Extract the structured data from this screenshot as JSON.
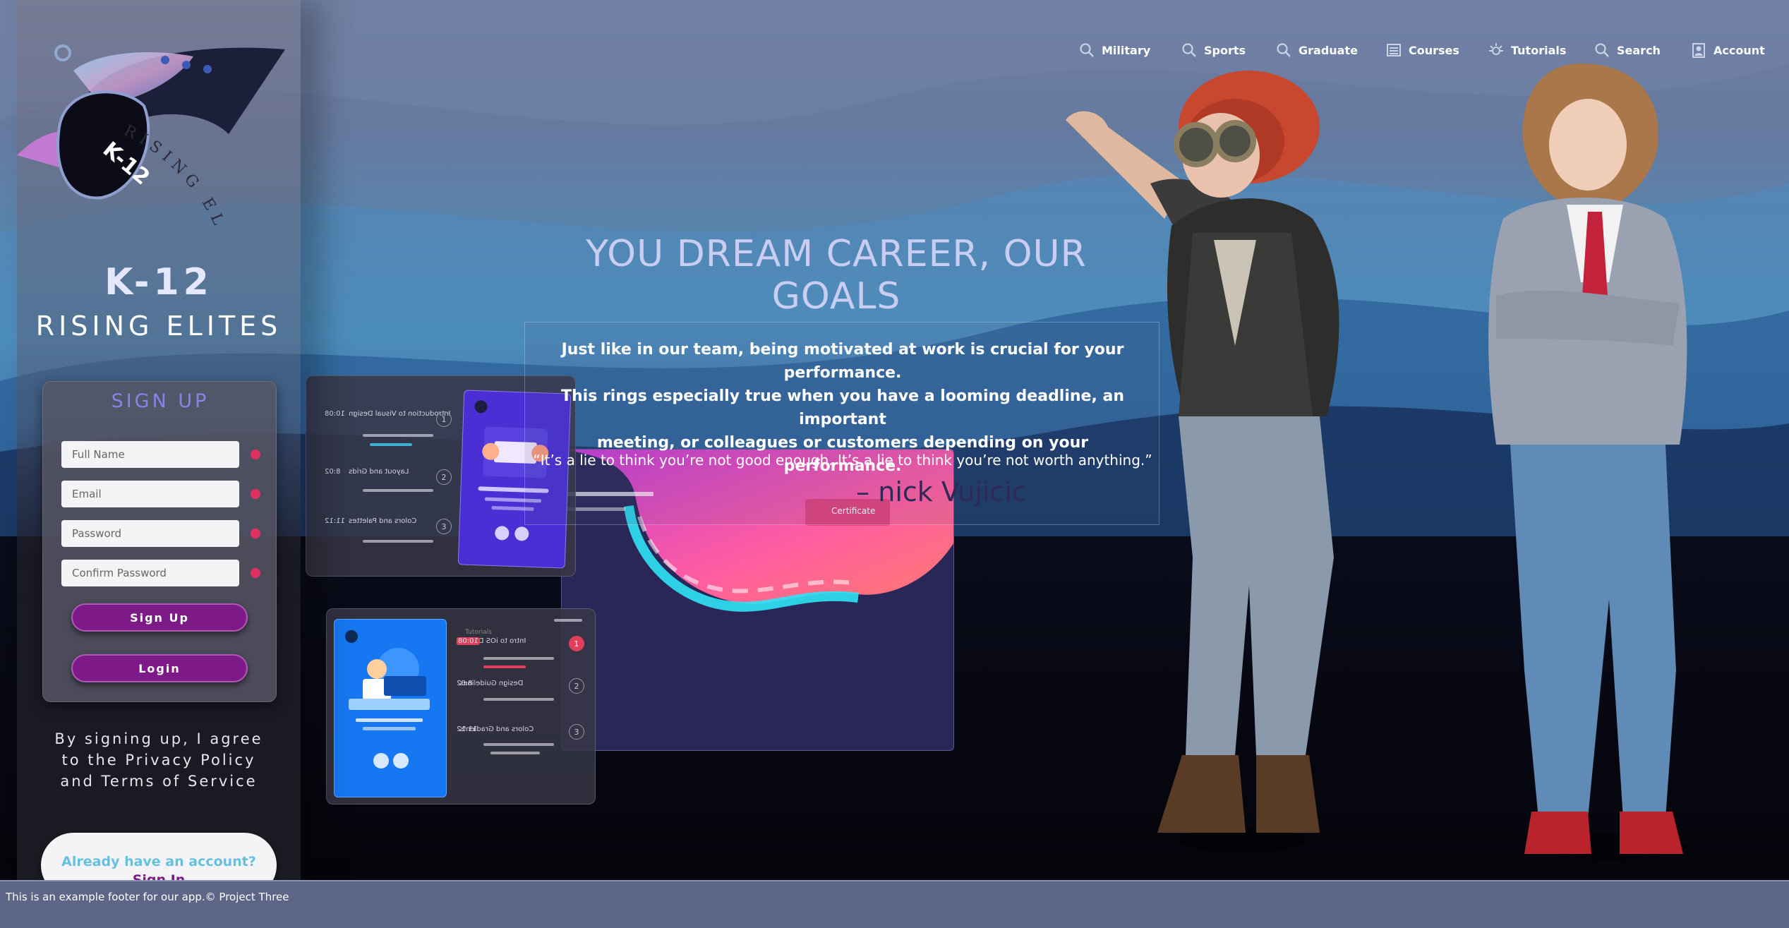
{
  "brand": {
    "k12": "K-12",
    "name": "RISING ELITES",
    "logo_text": "K-12",
    "logo_arc": "RISING ELITE"
  },
  "nav": {
    "items": [
      {
        "label": "Military",
        "icon": "search-icon"
      },
      {
        "label": "Sports",
        "icon": "search-icon"
      },
      {
        "label": "Graduate",
        "icon": "search-icon"
      },
      {
        "label": "Courses",
        "icon": "list-icon"
      },
      {
        "label": "Tutorials",
        "icon": "sparkle-icon"
      },
      {
        "label": "Search",
        "icon": "search-icon"
      },
      {
        "label": "Account",
        "icon": "user-icon"
      }
    ]
  },
  "signup": {
    "title": "SIGN UP",
    "full_name_placeholder": "Full Name",
    "email_placeholder": "Email",
    "password_placeholder": "Password",
    "confirm_placeholder": "Confirm Password",
    "signup_button": "Sign Up",
    "login_button": "Login",
    "required_color": "#e03060"
  },
  "agreement": {
    "line1": "By signing up, I agree",
    "line2": "to the Privacy Policy",
    "line3": "and Terms of Service"
  },
  "account": {
    "question": "Already have an account?",
    "link": "Sign In"
  },
  "hero": {
    "title": "YOU DREAM CAREER, OUR GOALS",
    "paragraph_line1": "Just like in our team, being motivated at work is crucial for your performance.",
    "paragraph_line2": "This rings especially true when you have a looming deadline, an important",
    "paragraph_line3": "meeting, or colleagues or customers depending on your performance.",
    "quote": "“It’s a lie to think you’re not good enough. It’s a lie to think you’re not worth anything.”",
    "author": "– nick Vujicic"
  },
  "mockup": {
    "certificate": "Certificate",
    "tutorials": "Tutorials",
    "upper_rows": [
      {
        "num": "1",
        "label": "Introduction to Visual Design",
        "time": "10:08"
      },
      {
        "num": "2",
        "label": "Layout and Grids",
        "time": "8:02"
      },
      {
        "num": "3",
        "label": "Colors and Palettes",
        "time": "11:12"
      }
    ],
    "lower_rows": [
      {
        "num": "1",
        "label": "Intro to iOS Design",
        "time": "10:08"
      },
      {
        "num": "2",
        "label": "Design Guidelines",
        "time": "8:02"
      },
      {
        "num": "3",
        "label": "Colors and Gradients",
        "time": "11:12"
      }
    ]
  },
  "footer": {
    "text": "This is an example footer for our app.© Project Three"
  },
  "colors": {
    "accent_purple": "#7e1a87",
    "signup_title": "#8b82e6",
    "link_blue": "#66c0e0"
  }
}
